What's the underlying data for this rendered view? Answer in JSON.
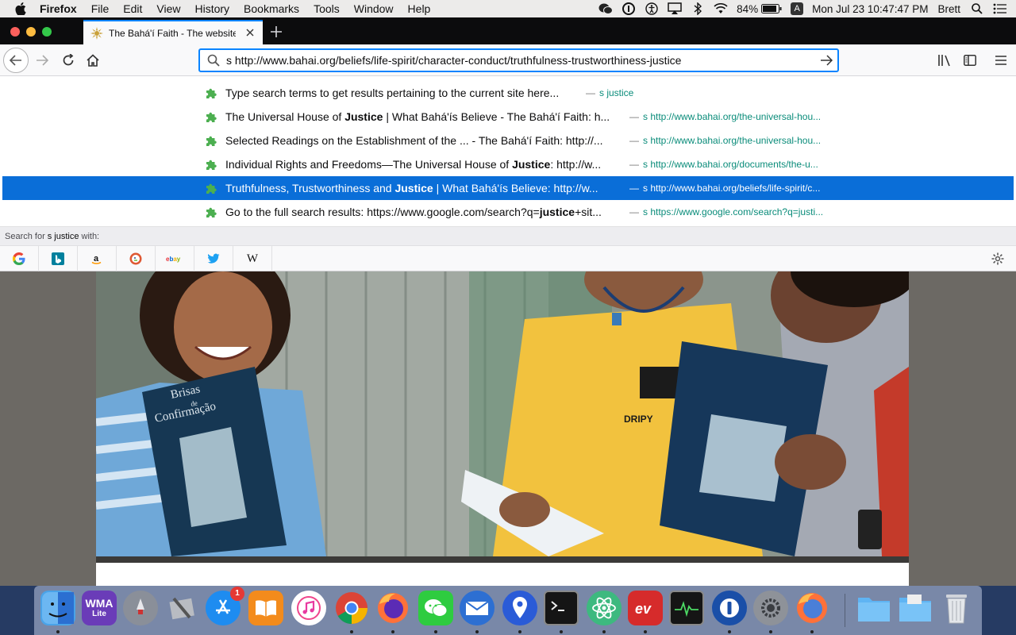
{
  "menubar": {
    "app_name": "Firefox",
    "menus": [
      "File",
      "Edit",
      "View",
      "History",
      "Bookmarks",
      "Tools",
      "Window",
      "Help"
    ],
    "battery_percent": "84%",
    "input_source": "A",
    "datetime": "Mon Jul 23  10:47:47 PM",
    "user": "Brett"
  },
  "browser": {
    "tab_title": "The Bahá'í Faith - The website of",
    "url_value": "s http://www.bahai.org/beliefs/life-spirit/character-conduct/truthfulness-trustworthiness-justice"
  },
  "autocomplete": {
    "rows": [
      {
        "title_before": "Type search terms to get results pertaining to the current site here...",
        "bold": "",
        "title_after": "",
        "url": "s justice",
        "selected": false
      },
      {
        "title_before": "The Universal House of ",
        "bold": "Justice",
        "title_after": " | What Bahá'ís Believe - The Bahá'í Faith: h...",
        "url": "s http://www.bahai.org/the-universal-hou...",
        "selected": false
      },
      {
        "title_before": "Selected Readings on the Establishment of the ... - The Bahá'í Faith: http://...",
        "bold": "",
        "title_after": "",
        "url": "s http://www.bahai.org/the-universal-hou...",
        "selected": false
      },
      {
        "title_before": "Individual Rights and Freedoms—The Universal House of ",
        "bold": "Justice",
        "title_after": ": http://w...",
        "url": "s http://www.bahai.org/documents/the-u...",
        "selected": false
      },
      {
        "title_before": "Truthfulness, Trustworthiness and ",
        "bold": "Justice",
        "title_after": " | What Bahá'ís Believe: http://w...",
        "url": "s http://www.bahai.org/beliefs/life-spirit/c...",
        "selected": true
      },
      {
        "title_before": "Go to the full search results: https://www.google.com/search?q=",
        "bold": "justice",
        "title_after": "+sit...",
        "url": "s https://www.google.com/search?q=justi...",
        "selected": false
      }
    ],
    "separator": "—"
  },
  "search_with": {
    "prefix": "Search for",
    "query": "s justice",
    "suffix": "with:"
  },
  "engines": [
    {
      "name": "google-engine-icon",
      "label": "G",
      "color": "#4285f4"
    },
    {
      "name": "bing-engine-icon",
      "label": "b",
      "color": "#00809d"
    },
    {
      "name": "amazon-engine-icon",
      "label": "a",
      "color": "#111111"
    },
    {
      "name": "duckduckgo-engine-icon",
      "label": "",
      "color": "#de5833"
    },
    {
      "name": "ebay-engine-icon",
      "label": "ebay",
      "color": "#e53238"
    },
    {
      "name": "twitter-engine-icon",
      "label": "",
      "color": "#1da1f2"
    },
    {
      "name": "wikipedia-engine-icon",
      "label": "W",
      "color": "#111111"
    }
  ],
  "photo": {
    "book_title_left": "Brisas",
    "book_title_left_de": "de",
    "book_title_left_2": "Confirmação",
    "shirt_text": "DRIPY"
  },
  "dock": {
    "wma_label": "WMA",
    "wma_sub": "Lite",
    "appstore_badge": "1"
  }
}
